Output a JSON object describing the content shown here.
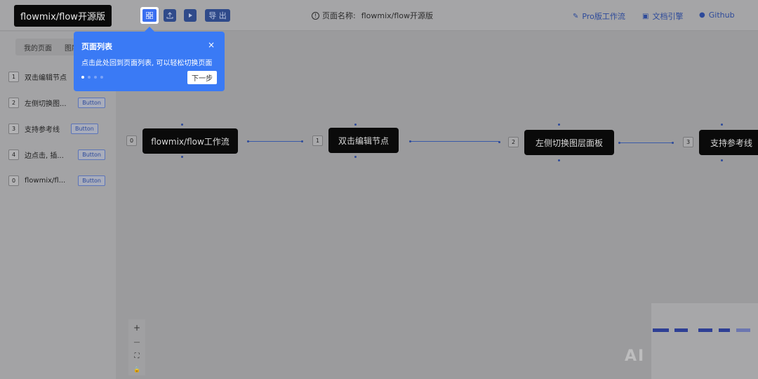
{
  "header": {
    "logo": "flowmix/flow开源版",
    "tools": {
      "page_list_icon": "grid-icon",
      "upload_icon": "upload-icon",
      "play_icon": "play-icon",
      "export_label": "导 出"
    },
    "page_name_label": "页面名称:",
    "page_name_value": "flowmix/flow开源版",
    "links": [
      {
        "icon": "brush-icon",
        "label": "Pro版工作流"
      },
      {
        "icon": "doc-icon",
        "label": "文档引擎"
      },
      {
        "icon": "github-icon",
        "label": "Github"
      }
    ]
  },
  "sidebar": {
    "tabs": [
      "我的页面",
      "图层"
    ],
    "items": [
      {
        "num": "1",
        "label": "双击编辑节点",
        "button": ""
      },
      {
        "num": "2",
        "label": "左侧切换图...",
        "button": "Button"
      },
      {
        "num": "3",
        "label": "支持参考线",
        "button": "Button"
      },
      {
        "num": "4",
        "label": "边点击, 插...",
        "button": "Button"
      },
      {
        "num": "0",
        "label": "flowmix/fl...",
        "button": "Button"
      }
    ]
  },
  "tooltip": {
    "title": "页面列表",
    "body": "点击此处回到页面列表, 可以轻松切换页面",
    "next": "下一步",
    "close": "×"
  },
  "canvas": {
    "nodes": [
      {
        "num": "0",
        "label": "flowmix/flow工作流"
      },
      {
        "num": "1",
        "label": "双击编辑节点"
      },
      {
        "num": "2",
        "label": "左侧切换图层面板"
      },
      {
        "num": "3",
        "label": "支持参考线"
      }
    ]
  },
  "zoom": {
    "plus": "+",
    "minus": "—",
    "fit": "⛶",
    "lock": "🔒"
  },
  "watermark": "AI"
}
